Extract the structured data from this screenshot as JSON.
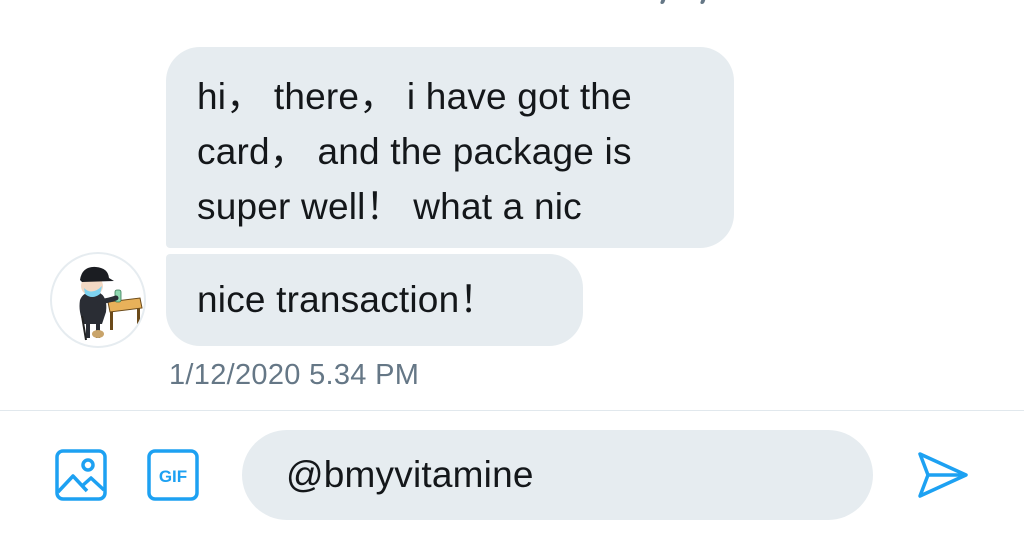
{
  "conversation": {
    "messages": [
      {
        "lines": [
          "hi， there， i have got the",
          "card， and the package is",
          "super well！ what a nic"
        ]
      },
      {
        "text": "nice transaction！"
      }
    ],
    "timestamp": "1/12/2020 5.34 PM",
    "avatar_icon": "user-avatar-cartoon"
  },
  "composer": {
    "value": "@bmyvitamine",
    "image_icon": "image-icon",
    "gif_icon": "gif-icon",
    "gif_label": "GIF",
    "send_icon": "send-icon"
  },
  "colors": {
    "accent": "#1da1f2",
    "bubble": "#e6ecf0",
    "muted_text": "#657786",
    "text": "#14171a"
  }
}
